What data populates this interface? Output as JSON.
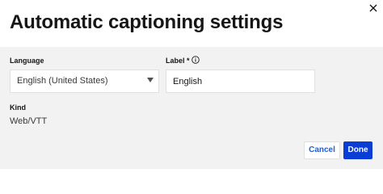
{
  "dialog": {
    "title": "Automatic captioning settings",
    "close_icon": "close-icon"
  },
  "form": {
    "language": {
      "label": "Language",
      "selected_value": "English (United States)",
      "arrow_icon": "chevron-down-icon"
    },
    "label_field": {
      "label": "Label *",
      "info_icon": "info-icon",
      "value": "English"
    },
    "kind": {
      "label": "Kind",
      "value": "Web/VTT"
    }
  },
  "footer": {
    "cancel_label": "Cancel",
    "done_label": "Done"
  },
  "colors": {
    "primary": "#0a3dd6",
    "link": "#0f62fe",
    "panel_bg": "#f2f2f2"
  }
}
